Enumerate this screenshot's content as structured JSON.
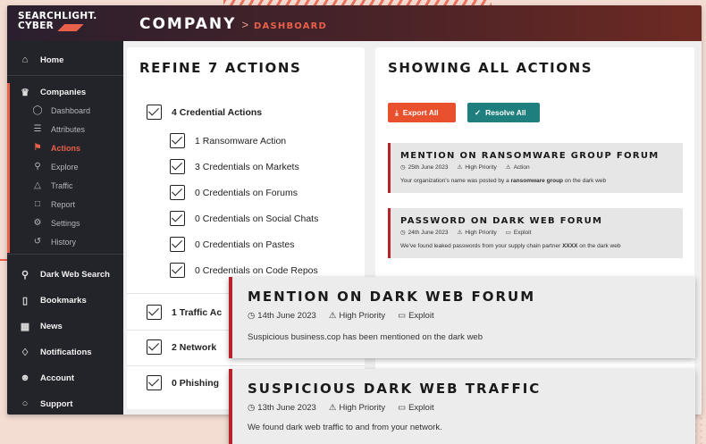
{
  "brand": {
    "logo_line1": "SEARCHLIGHT.",
    "logo_line2": "CYBER"
  },
  "header": {
    "title": "COMPANY",
    "separator": ">",
    "subtitle": "DASHBOARD"
  },
  "sidebar": {
    "top": [
      {
        "label": "Home",
        "icon": "home-icon"
      }
    ],
    "companies": {
      "label": "Companies",
      "icon": "companies-icon"
    },
    "sub_items": [
      {
        "label": "Dashboard",
        "icon": "dashboard-icon"
      },
      {
        "label": "Attributes",
        "icon": "list-icon"
      },
      {
        "label": "Actions",
        "icon": "actions-icon",
        "active": true
      },
      {
        "label": "Explore",
        "icon": "search-icon"
      },
      {
        "label": "Traffic",
        "icon": "traffic-icon"
      },
      {
        "label": "Report",
        "icon": "document-icon"
      },
      {
        "label": "Settings",
        "icon": "gear-icon"
      },
      {
        "label": "History",
        "icon": "history-icon"
      }
    ],
    "bottom": [
      {
        "label": "Dark Web Search",
        "icon": "search-icon"
      },
      {
        "label": "Bookmarks",
        "icon": "bookmark-icon"
      },
      {
        "label": "News",
        "icon": "news-icon"
      },
      {
        "label": "Notifications",
        "icon": "bell-icon"
      },
      {
        "label": "Account",
        "icon": "user-icon"
      },
      {
        "label": "Support",
        "icon": "chat-icon"
      }
    ]
  },
  "refine": {
    "title": "REFINE 7 ACTIONS",
    "groups": [
      {
        "label": "4 Credential Actions",
        "children": [
          "1 Ransomware Action",
          "3 Credentials on Markets",
          "0 Credentials on Forums",
          "0 Credentials on Social Chats",
          "0 Credentials on Pastes",
          "0 Credentials on Code Repos"
        ]
      },
      {
        "label": "1 Traffic Ac"
      },
      {
        "label": "2 Network"
      },
      {
        "label": "0 Phishing"
      }
    ]
  },
  "actions": {
    "title": "SHOWING ALL ACTIONS",
    "export_label": "Export All",
    "resolve_label": "Resolve All",
    "colors": {
      "export": "#e8502e",
      "resolve": "#1f7f7f",
      "accent": "#b8232b"
    },
    "cards": [
      {
        "title": "MENTION ON RANSOMWARE GROUP FORUM",
        "date": "25th June 2023",
        "priority": "High Priority",
        "type": "Action",
        "desc_pre": "Your organization's name was posted by a ",
        "desc_bold": "ransomware group",
        "desc_post": " on the dark web"
      },
      {
        "title": "PASSWORD ON DARK WEB FORUM",
        "date": "24th June 2023",
        "priority": "High Priority",
        "type": "Exploit",
        "desc_pre": "We've found leaked passwords from your supply chain partner ",
        "desc_bold": "XXXX",
        "desc_post": " on the dark web"
      }
    ]
  },
  "overlays": [
    {
      "title": "MENTION ON DARK WEB FORUM",
      "date": "14th June 2023",
      "priority": "High Priority",
      "type": "Exploit",
      "desc": "Suspicious business.cop has been mentioned on the dark web"
    },
    {
      "title": "SUSPICIOUS DARK WEB TRAFFIC",
      "date": "13th June 2023",
      "priority": "High Priority",
      "type": "Exploit",
      "desc": "We found dark web traffic to and from your network."
    }
  ]
}
